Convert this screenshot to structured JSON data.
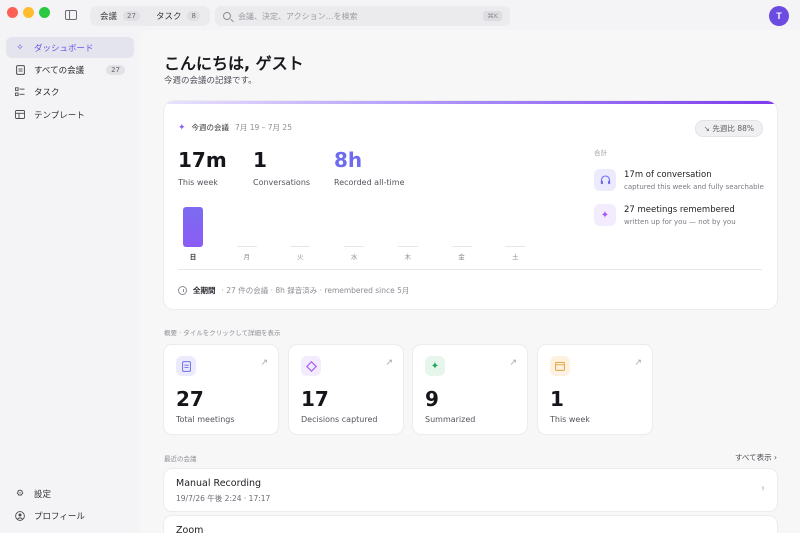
{
  "titlebar": {
    "tabs": [
      {
        "label": "会議",
        "count": "27"
      },
      {
        "label": "タスク",
        "count": "8"
      }
    ],
    "search_placeholder": "会議、決定、アクション…を検索",
    "search_shortcut": "⌘K",
    "avatar_initial": "T"
  },
  "sidebar": {
    "items": [
      {
        "label": "ダッシュボード",
        "icon": "sparkle-icon",
        "active": true
      },
      {
        "label": "すべての会議",
        "icon": "document-icon",
        "badge": "27"
      },
      {
        "label": "タスク",
        "icon": "checklist-icon"
      },
      {
        "label": "テンプレート",
        "icon": "template-icon"
      }
    ],
    "bottom": [
      {
        "label": "設定",
        "icon": "gear-icon"
      },
      {
        "label": "プロフィール",
        "icon": "person-icon"
      }
    ]
  },
  "main": {
    "greeting": "こんにちは, ゲスト",
    "subtitle": "今週の会議の記録です。",
    "week": {
      "title": "今週の会議",
      "range": "7月 19 – 7月 25",
      "comparison": "↘ 先週比 88%",
      "stats": [
        {
          "value": "17m",
          "label": "This week"
        },
        {
          "value": "1",
          "label": "Conversations"
        },
        {
          "value": "8h",
          "label": "Recorded all-time"
        }
      ],
      "days": [
        {
          "label": "日",
          "value": 1
        },
        {
          "label": "月",
          "value": 0
        },
        {
          "label": "火",
          "value": 0
        },
        {
          "label": "水",
          "value": 0
        },
        {
          "label": "木",
          "value": 0
        },
        {
          "label": "金",
          "value": 0
        },
        {
          "label": "土",
          "value": 0
        }
      ],
      "footer_strong": "全期間",
      "footer_rest": "· 27 件の会議 · 8h 録音済み · remembered since 5月",
      "highlights_label": "合計",
      "highlights": [
        {
          "title": "17m of conversation",
          "sub": "captured this week and fully searchable",
          "icon": "headphones-icon"
        },
        {
          "title": "27 meetings remembered",
          "sub": "written up for you — not by you",
          "icon": "sparkle-icon"
        }
      ]
    },
    "overview_label": "概要 · タイルをクリックして詳細を表示",
    "tiles": [
      {
        "value": "27",
        "label": "Total meetings",
        "icon": "document-icon",
        "color": "#6f6bef",
        "bg": "#ecebfd"
      },
      {
        "value": "17",
        "label": "Decisions captured",
        "icon": "diamond-icon",
        "color": "#a855f7",
        "bg": "#f3ebfe"
      },
      {
        "value": "9",
        "label": "Summarized",
        "icon": "sparkle-icon",
        "color": "#22a55a",
        "bg": "#e6f6ec"
      },
      {
        "value": "1",
        "label": "This week",
        "icon": "calendar-icon",
        "color": "#e6a23c",
        "bg": "#fdf2e2"
      }
    ],
    "recent_label": "最近の会議",
    "see_all": "すべて表示 ›",
    "recent": [
      {
        "title": "Manual Recording",
        "time": "19/7/26 午後 2:24 · 17:17"
      },
      {
        "title": "Zoom",
        "time": ""
      }
    ]
  }
}
